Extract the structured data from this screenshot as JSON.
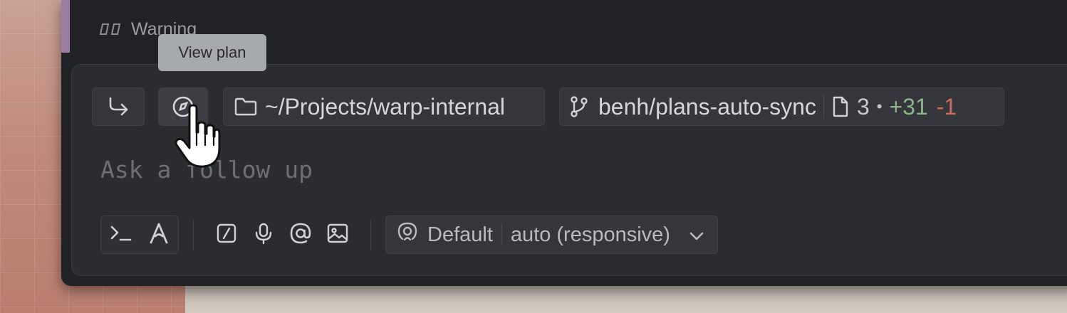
{
  "warning": {
    "label": "Warning",
    "icon": "warning-glyph-icon"
  },
  "tooltip": {
    "text": "View plan"
  },
  "chips": {
    "forward": {
      "icon": "arrow-turn-right-icon"
    },
    "plan": {
      "icon": "plan-compass-icon"
    },
    "directory": {
      "icon": "folder-icon",
      "path": "~/Projects/warp-internal"
    },
    "git": {
      "icon": "git-branch-icon",
      "branch": "benh/plans-auto-sync",
      "file_icon": "file-icon",
      "files_changed": "3",
      "bullet": "•",
      "additions": "+31",
      "deletions": "-1"
    }
  },
  "input": {
    "placeholder": "Ask a follow up",
    "value": ""
  },
  "bottom": {
    "modes": [
      "terminal-prompt-icon",
      "agent-a-icon"
    ],
    "tools": [
      "slash-command-icon",
      "microphone-icon",
      "at-mention-icon",
      "image-icon"
    ],
    "model": {
      "icon": "profile-icon",
      "profile": "Default",
      "model": "auto (responsive)",
      "chevron": "chevron-down-icon"
    }
  },
  "colors": {
    "window_bg": "#202226",
    "panel_bg": "#2a2c30",
    "chip_bg": "#34363b",
    "added": "#8fb38a",
    "removed": "#d06a60",
    "accent_strip": "#9d7ea3"
  }
}
